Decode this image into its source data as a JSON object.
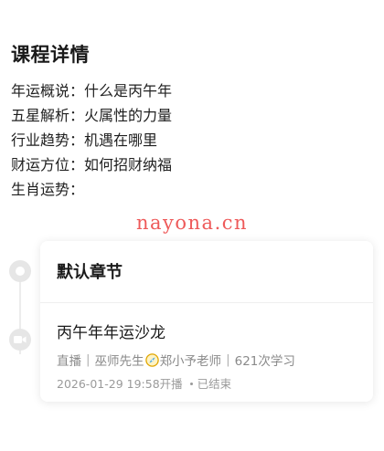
{
  "course": {
    "section_title": "课程详情",
    "details": [
      "年运概说：什么是丙午年",
      "五星解析：火属性的力量",
      "行业趋势：机遇在哪里",
      "财运方位：如何招财纳福",
      "生肖运势："
    ]
  },
  "watermark": "nayona.cn",
  "chapter": {
    "title": "默认章节",
    "lesson": {
      "title": "丙午年年运沙龙",
      "type": "直播",
      "teacher_1": "巫师先生",
      "teacher_2": "郑小予老师",
      "views": "621次学习",
      "datetime": "2026-01-29 19:58开播",
      "status": "已结束"
    }
  },
  "icons": {
    "timeline_1": "circle-node-icon",
    "timeline_2": "video-camera-icon",
    "separator": "compass-icon"
  },
  "colors": {
    "watermark": "#ee5a5a",
    "meta_text": "#8a8a8a"
  }
}
